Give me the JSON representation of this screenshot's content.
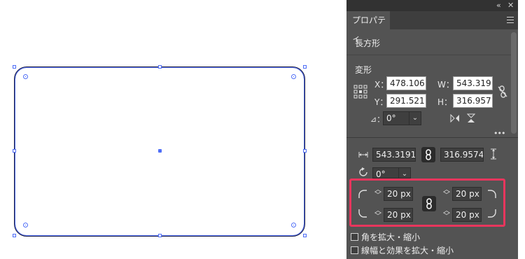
{
  "panel": {
    "title_controls": {
      "collapse": "«",
      "close": "✕"
    },
    "tab_label": "プロパティ",
    "object_type": "長方形",
    "transform": {
      "section_title": "変形",
      "x_label": "X：",
      "x_value": "478.106",
      "y_label": "Y：",
      "y_value": "291.521",
      "w_label": "W：",
      "w_value": "543.319",
      "h_label": "H：",
      "h_value": "316.957",
      "angle_label": "⊿：",
      "angle_value": "0°",
      "more": "•••"
    },
    "rect_props": {
      "width_value": "543.3191",
      "height_value": "316.9574",
      "rotation_value": "0°",
      "corners": {
        "top_left": "20 px",
        "bottom_left": "20 px",
        "top_right": "20 px",
        "bottom_right": "20 px"
      },
      "scale_corners_label": "角を拡大・縮小",
      "scale_strokes_label": "線幅と効果を拡大・縮小"
    }
  },
  "colors": {
    "panel_bg": "#535353",
    "selection": "#4f6ef7",
    "highlight": "#e8365d"
  }
}
